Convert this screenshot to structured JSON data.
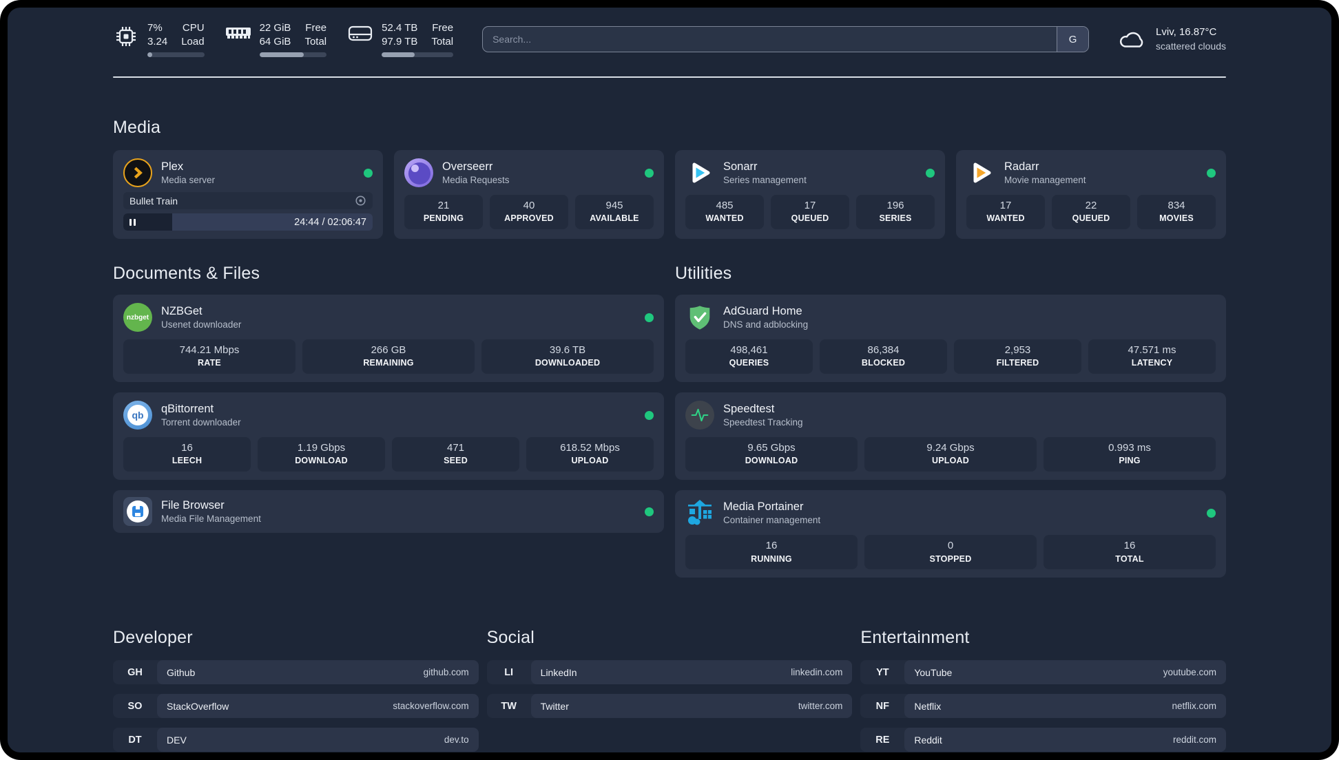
{
  "palette": {
    "background": "#1d2637",
    "card": "#2a3346",
    "tile": "#222b3d",
    "status_online_green": "#1fc77e",
    "plex_orange": "#e8a31c",
    "sonarr_cyan": "#36c3f2",
    "radarr_orange": "#f6a72b",
    "nzbget_green": "#63b54d",
    "adguard_green": "#5fbf75",
    "speedtest_pulse_green": "#2fd286",
    "portainer_blue": "#1ea7e0",
    "divider": "#d9dee6"
  },
  "topbar": {
    "widgets": [
      {
        "icon": "cpu-icon",
        "rows": [
          {
            "value": "7%",
            "label": "CPU"
          },
          {
            "value": "3.24",
            "label": "Load"
          }
        ],
        "progress_pct": 8
      },
      {
        "icon": "memory-icon",
        "rows": [
          {
            "value": "22 GiB",
            "label": "Free"
          },
          {
            "value": "64 GiB",
            "label": "Total"
          }
        ],
        "progress_pct": 66
      },
      {
        "icon": "disk-icon",
        "rows": [
          {
            "value": "52.4 TB",
            "label": "Free"
          },
          {
            "value": "97.9 TB",
            "label": "Total"
          }
        ],
        "progress_pct": 46
      }
    ],
    "search": {
      "placeholder": "Search...",
      "button_label": "G"
    },
    "weather": {
      "icon": "cloud-icon",
      "location": "Lviv, 16.87°C",
      "condition": "scattered clouds"
    }
  },
  "sections": {
    "media": {
      "title": "Media",
      "services": [
        {
          "name": "Plex",
          "description": "Media server",
          "icon": "plex-icon",
          "online": true,
          "now_playing": {
            "title": "Bullet Train",
            "time_display": "24:44 / 02:06:47",
            "progress_pct": 19.5,
            "state": "paused"
          }
        },
        {
          "name": "Overseerr",
          "description": "Media Requests",
          "icon": "overseerr-icon",
          "online": true,
          "stats": [
            {
              "value": "21",
              "label": "PENDING"
            },
            {
              "value": "40",
              "label": "APPROVED"
            },
            {
              "value": "945",
              "label": "AVAILABLE"
            }
          ]
        },
        {
          "name": "Sonarr",
          "description": "Series management",
          "icon": "sonarr-icon",
          "online": true,
          "stats": [
            {
              "value": "485",
              "label": "WANTED"
            },
            {
              "value": "17",
              "label": "QUEUED"
            },
            {
              "value": "196",
              "label": "SERIES"
            }
          ]
        },
        {
          "name": "Radarr",
          "description": "Movie management",
          "icon": "radarr-icon",
          "online": true,
          "stats": [
            {
              "value": "17",
              "label": "WANTED"
            },
            {
              "value": "22",
              "label": "QUEUED"
            },
            {
              "value": "834",
              "label": "MOVIES"
            }
          ]
        }
      ]
    },
    "documents": {
      "title": "Documents & Files",
      "services": [
        {
          "name": "NZBGet",
          "description": "Usenet downloader",
          "icon": "nzbget-icon",
          "online": true,
          "stats": [
            {
              "value": "744.21 Mbps",
              "label": "RATE"
            },
            {
              "value": "266 GB",
              "label": "REMAINING"
            },
            {
              "value": "39.6 TB",
              "label": "DOWNLOADED"
            }
          ]
        },
        {
          "name": "qBittorrent",
          "description": "Torrent downloader",
          "icon": "qbittorrent-icon",
          "online": true,
          "stats": [
            {
              "value": "16",
              "label": "LEECH"
            },
            {
              "value": "1.19 Gbps",
              "label": "DOWNLOAD"
            },
            {
              "value": "471",
              "label": "SEED"
            },
            {
              "value": "618.52 Mbps",
              "label": "UPLOAD"
            }
          ]
        },
        {
          "name": "File Browser",
          "description": "Media File Management",
          "icon": "filebrowser-icon",
          "online": true,
          "stats": []
        }
      ]
    },
    "utilities": {
      "title": "Utilities",
      "services": [
        {
          "name": "AdGuard Home",
          "description": "DNS and adblocking",
          "icon": "adguard-icon",
          "online": false,
          "stats": [
            {
              "value": "498,461",
              "label": "QUERIES"
            },
            {
              "value": "86,384",
              "label": "BLOCKED"
            },
            {
              "value": "2,953",
              "label": "FILTERED"
            },
            {
              "value": "47.571 ms",
              "label": "LATENCY"
            }
          ]
        },
        {
          "name": "Speedtest",
          "description": "Speedtest Tracking",
          "icon": "speedtest-icon",
          "online": false,
          "stats": [
            {
              "value": "9.65 Gbps",
              "label": "DOWNLOAD"
            },
            {
              "value": "9.24 Gbps",
              "label": "UPLOAD"
            },
            {
              "value": "0.993 ms",
              "label": "PING"
            }
          ]
        },
        {
          "name": "Media Portainer",
          "description": "Container management",
          "icon": "portainer-icon",
          "online": true,
          "stats": [
            {
              "value": "16",
              "label": "RUNNING"
            },
            {
              "value": "0",
              "label": "STOPPED"
            },
            {
              "value": "16",
              "label": "TOTAL"
            }
          ]
        }
      ]
    },
    "bookmarks": [
      {
        "title": "Developer",
        "links": [
          {
            "abbr": "GH",
            "name": "Github",
            "url": "github.com"
          },
          {
            "abbr": "SO",
            "name": "StackOverflow",
            "url": "stackoverflow.com"
          },
          {
            "abbr": "DT",
            "name": "DEV",
            "url": "dev.to"
          }
        ]
      },
      {
        "title": "Social",
        "links": [
          {
            "abbr": "LI",
            "name": "LinkedIn",
            "url": "linkedin.com"
          },
          {
            "abbr": "TW",
            "name": "Twitter",
            "url": "twitter.com"
          }
        ]
      },
      {
        "title": "Entertainment",
        "links": [
          {
            "abbr": "YT",
            "name": "YouTube",
            "url": "youtube.com"
          },
          {
            "abbr": "NF",
            "name": "Netflix",
            "url": "netflix.com"
          },
          {
            "abbr": "RE",
            "name": "Reddit",
            "url": "reddit.com"
          }
        ]
      }
    ]
  }
}
